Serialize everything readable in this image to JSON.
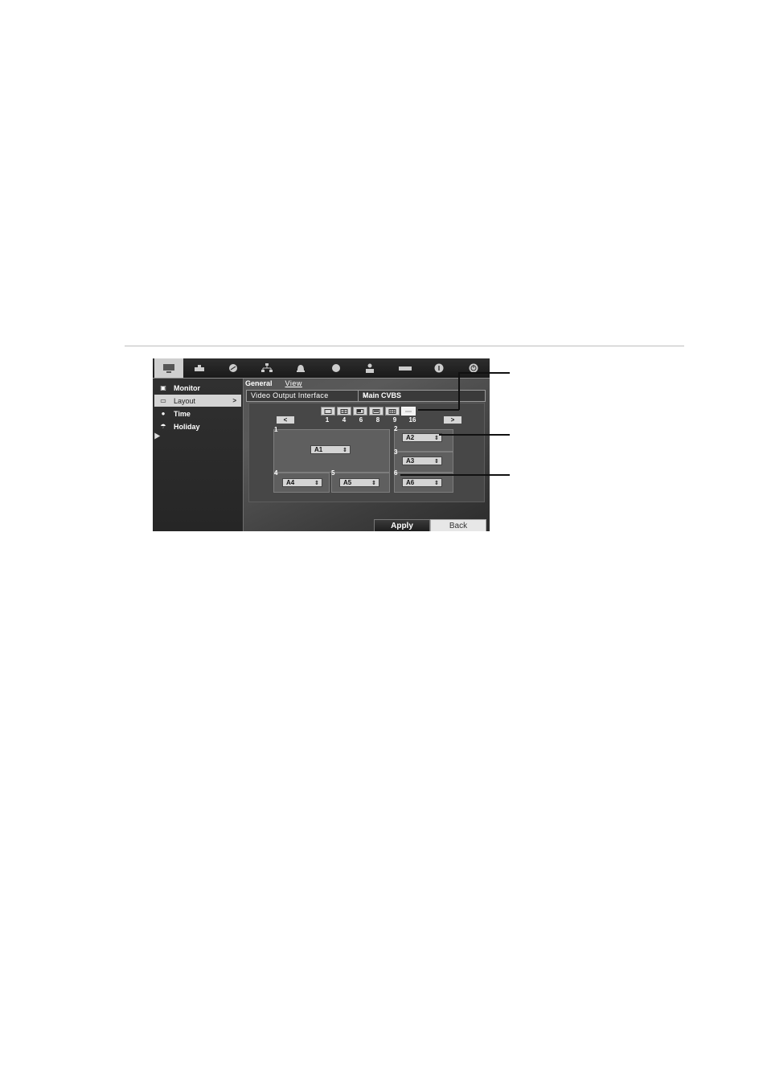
{
  "toolbar": {
    "icons": [
      "display-icon",
      "recording-icon",
      "schedule-icon",
      "network-icon",
      "alarm-icon",
      "device-icon",
      "user-icon",
      "storage-icon",
      "info-icon",
      "power-icon"
    ]
  },
  "sidebar": {
    "items": [
      {
        "label": "Monitor",
        "icon": "monitor-icon"
      },
      {
        "label": "Layout",
        "icon": "layout-icon",
        "chevron": ">"
      },
      {
        "label": "Time",
        "icon": "time-icon"
      },
      {
        "label": "Holiday",
        "icon": "holiday-icon"
      }
    ]
  },
  "tabs": {
    "general": "General",
    "view": "View"
  },
  "video_output": {
    "label": "Video Output Interface",
    "value": "Main CVBS",
    "arrow": "⌄"
  },
  "layout": {
    "numbers": [
      "1",
      "4",
      "6",
      "8",
      "9",
      "16"
    ],
    "prev": "<",
    "next": ">",
    "cells": [
      {
        "num": "1",
        "value": "A1"
      },
      {
        "num": "2",
        "value": "A2"
      },
      {
        "num": "3",
        "value": "A3"
      },
      {
        "num": "4",
        "value": "A4"
      },
      {
        "num": "5",
        "value": "A5"
      },
      {
        "num": "6",
        "value": "A6"
      }
    ]
  },
  "buttons": {
    "apply": "Apply",
    "back": "Back"
  }
}
